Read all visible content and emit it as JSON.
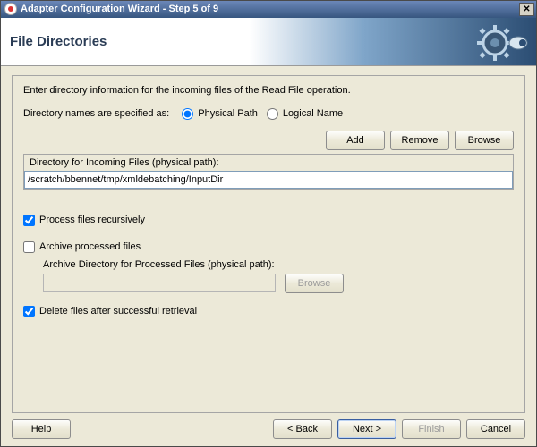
{
  "titlebar": {
    "text": "Adapter Configuration Wizard - Step 5 of 9",
    "close": "✕"
  },
  "banner": {
    "title": "File Directories"
  },
  "intro": "Enter directory information for the incoming files of the Read File operation.",
  "spec": {
    "label": "Directory names are specified as:",
    "physical": "Physical Path",
    "logical": "Logical Name",
    "selected": "physical"
  },
  "toolbar": {
    "add": "Add",
    "remove": "Remove",
    "browse": "Browse"
  },
  "incoming": {
    "label": "Directory for Incoming Files (physical path):",
    "value": "/scratch/bbennet/tmp/xmldebatching/InputDir"
  },
  "recursive": {
    "label": "Process files recursively",
    "checked": true
  },
  "archive": {
    "check_label": "Archive processed files",
    "checked": false,
    "sub_label": "Archive Directory for Processed Files (physical path):",
    "value": "",
    "browse": "Browse"
  },
  "delete_after": {
    "label": "Delete files after successful retrieval",
    "checked": true
  },
  "footer": {
    "help": "Help",
    "back": "< Back",
    "next": "Next >",
    "finish": "Finish",
    "cancel": "Cancel"
  }
}
